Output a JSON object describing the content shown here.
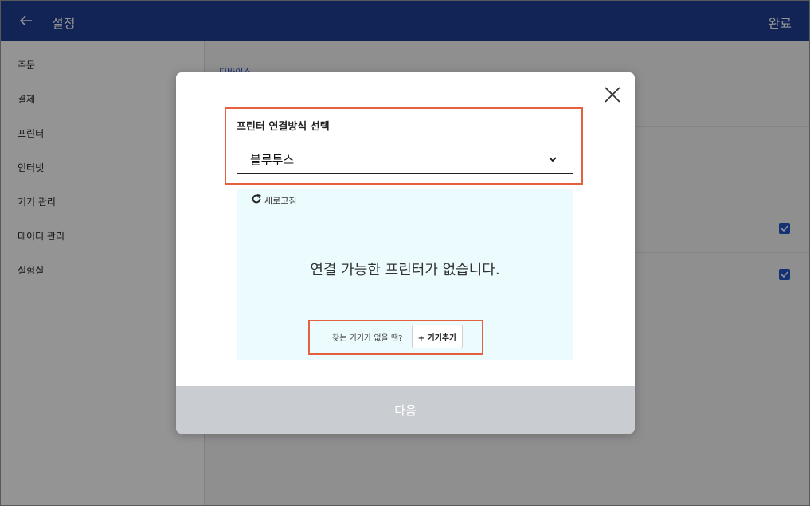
{
  "header": {
    "title": "설정",
    "done_label": "완료",
    "back_icon": "arrow-left-icon"
  },
  "sidebar": {
    "items": [
      {
        "label": "주문"
      },
      {
        "label": "결제"
      },
      {
        "label": "프린터"
      },
      {
        "label": "인터넷"
      },
      {
        "label": "기기 관리"
      },
      {
        "label": "데이터 관리"
      },
      {
        "label": "실험실"
      }
    ]
  },
  "content": {
    "section_title": "디바이스",
    "checkboxes": [
      true,
      true
    ]
  },
  "modal": {
    "select_label": "프린터 연결방식 선택",
    "select_value": "블루투스",
    "refresh_label": "새로고침",
    "empty_message": "연결 가능한 프린터가 없습니다.",
    "add_hint": "찾는 기기가 없을 땐?",
    "add_device_label": "+ 기기추가",
    "next_label": "다음"
  },
  "colors": {
    "header_bg": "#1f3f94",
    "highlight": "#e4603f",
    "list_bg": "#ecfbfd",
    "next_disabled": "#c9ccd0",
    "checkbox": "#2455c8"
  }
}
